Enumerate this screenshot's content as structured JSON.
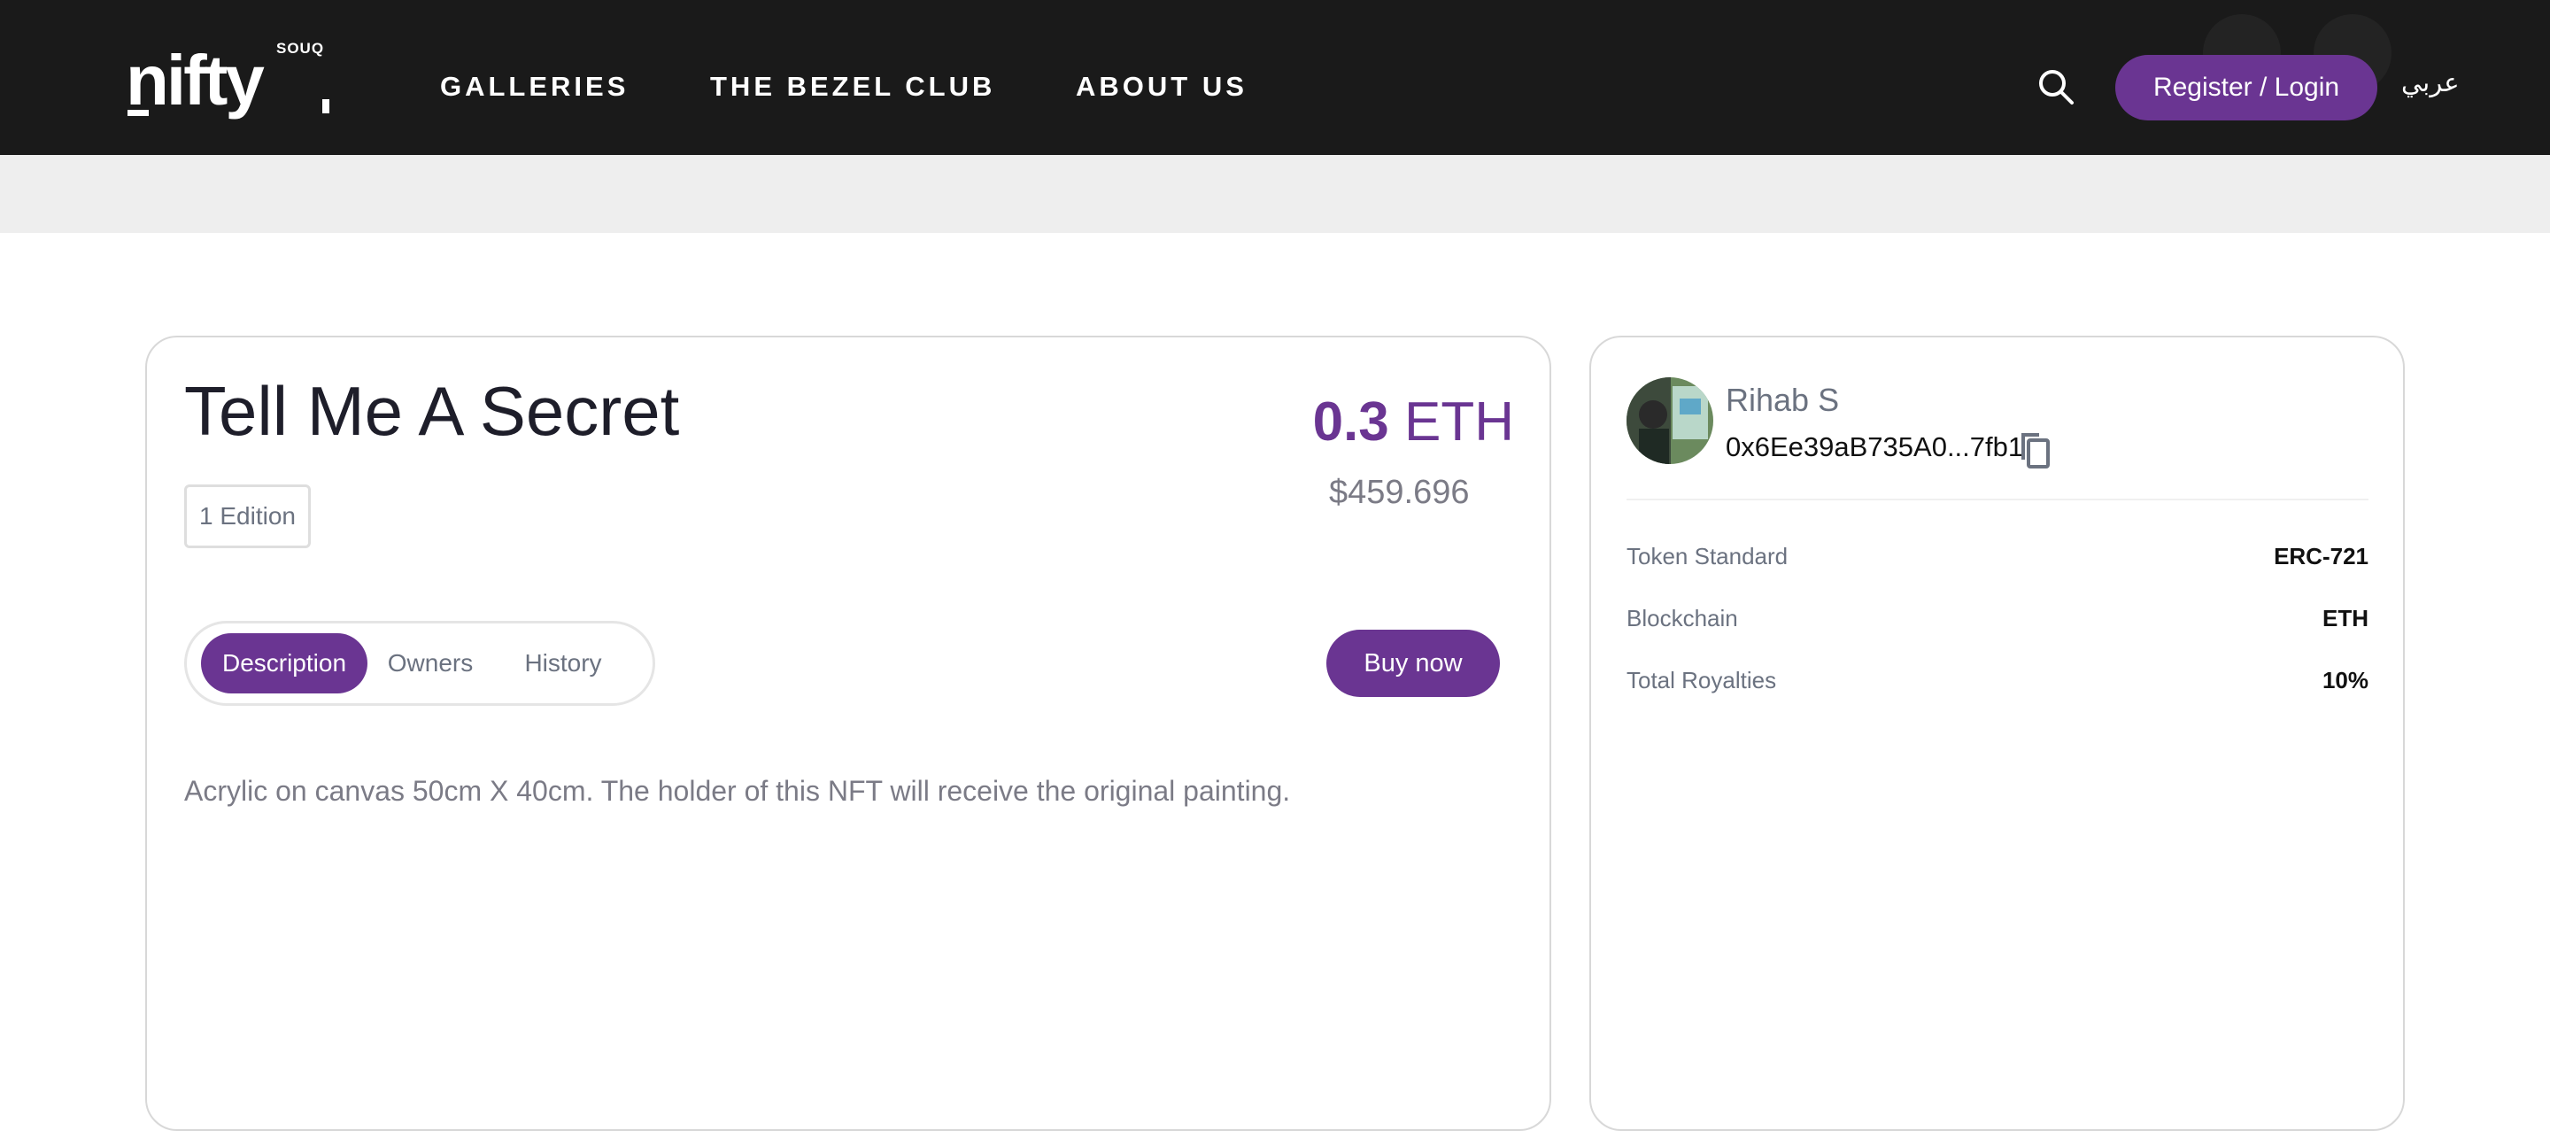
{
  "header": {
    "logo_text": "nifty",
    "logo_sub": "SOUQ",
    "nav": [
      "GALLERIES",
      "THE BEZEL CLUB",
      "ABOUT US"
    ],
    "login_label": "Register / Login",
    "language_label": "عربي"
  },
  "item": {
    "title": "Tell Me A Secret",
    "edition": "1 Edition",
    "price_value": "0.3",
    "price_unit": "ETH",
    "price_usd": "$459.696",
    "tabs": [
      "Description",
      "Owners",
      "History"
    ],
    "active_tab": "Description",
    "buy_label": "Buy now",
    "description": "Acrylic on canvas 50cm X 40cm. The holder of this NFT will receive the original painting."
  },
  "owner": {
    "name": "Rihab S",
    "address": "0x6Ee39aB735A0...7fb1"
  },
  "details": [
    {
      "label": "Token Standard",
      "value": "ERC-721"
    },
    {
      "label": "Blockchain",
      "value": "ETH"
    },
    {
      "label": "Total Royalties",
      "value": "10%"
    }
  ],
  "colors": {
    "accent": "#6a3592",
    "header_bg": "#1a1a1a"
  }
}
